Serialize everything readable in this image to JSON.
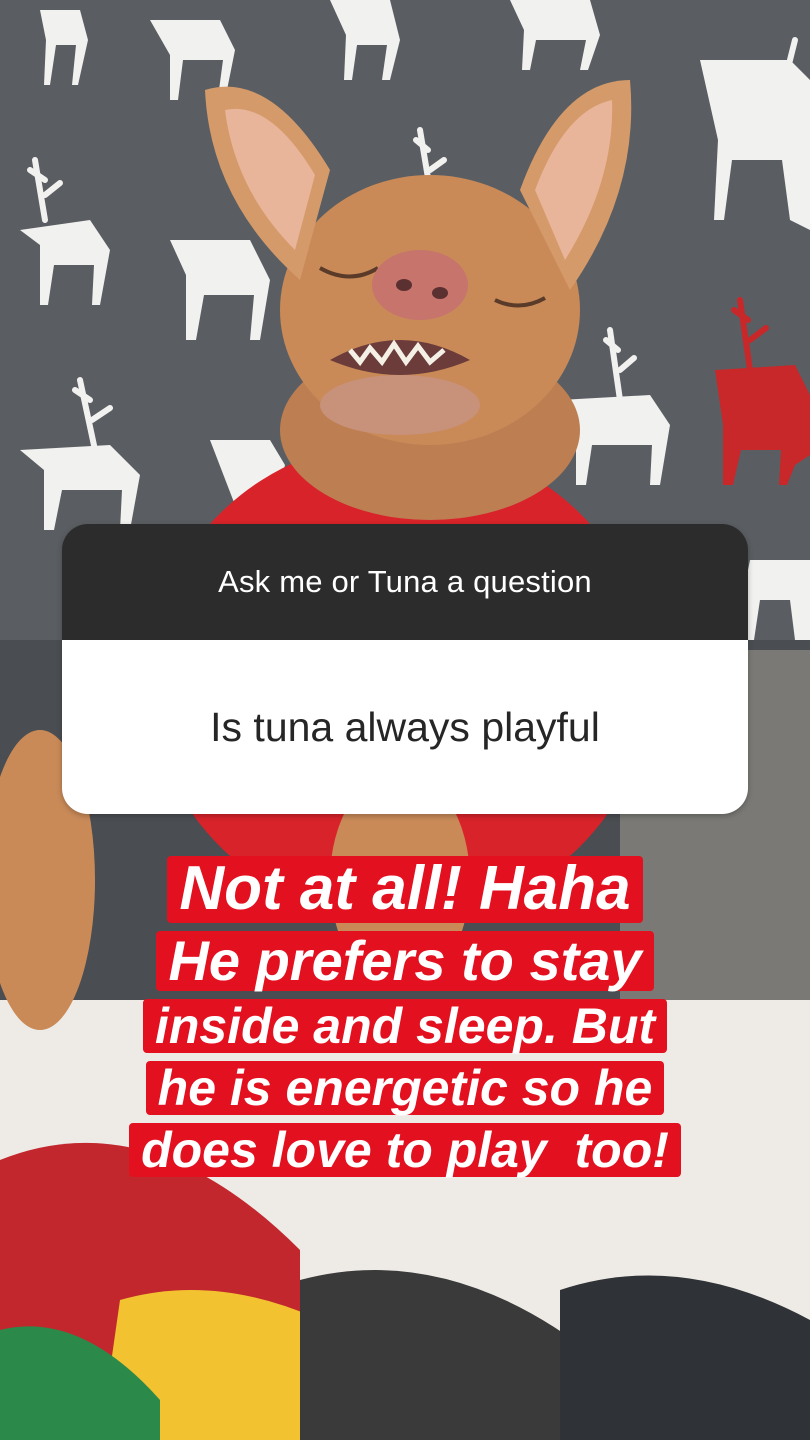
{
  "question_sticker": {
    "prompt": "Ask me or Tuna a question",
    "answer_question": "Is tuna always playful"
  },
  "caption": {
    "lines": [
      "Not at all! Haha",
      "He prefers to stay",
      "inside and sleep. But",
      "he is energetic so he",
      "does love to play  too!"
    ],
    "highlight_color": "#e3101f",
    "text_color": "#ffffff"
  },
  "photo": {
    "subject": "chihuahua-dog-in-red-sweater",
    "background_pattern": "reindeer-print-blanket",
    "colors": {
      "blanket_gray": "#5a5e62",
      "reindeer_white": "#f1f1ef",
      "reindeer_red": "#c8282a",
      "dog_fur": "#c98a58",
      "sweater_red": "#d8232a"
    }
  }
}
